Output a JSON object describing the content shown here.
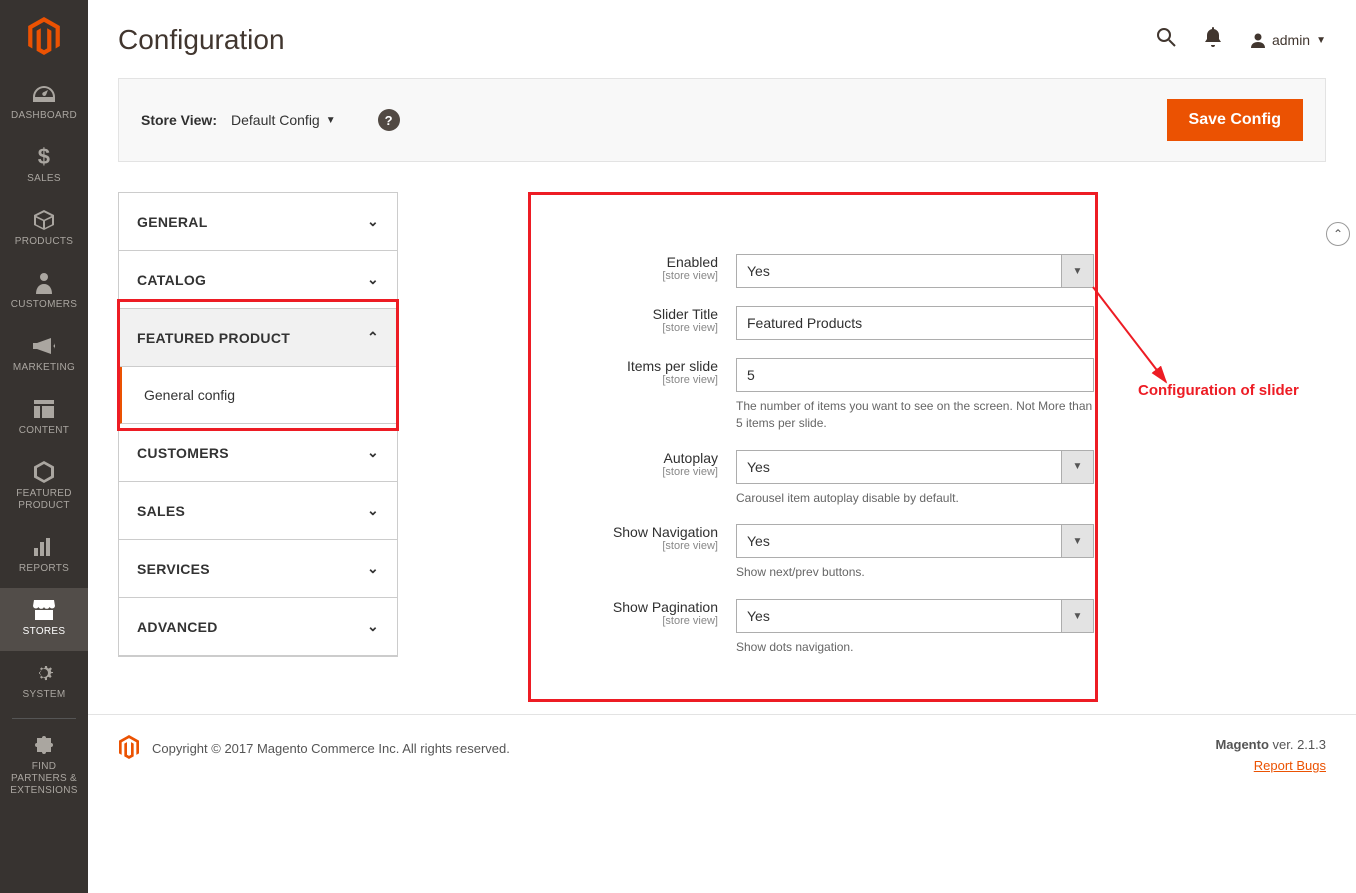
{
  "nav": {
    "items": [
      {
        "key": "dashboard",
        "label": "DASHBOARD"
      },
      {
        "key": "sales",
        "label": "SALES"
      },
      {
        "key": "products",
        "label": "PRODUCTS"
      },
      {
        "key": "customers",
        "label": "CUSTOMERS"
      },
      {
        "key": "marketing",
        "label": "MARKETING"
      },
      {
        "key": "content",
        "label": "CONTENT"
      },
      {
        "key": "featured-product",
        "label": "FEATURED PRODUCT"
      },
      {
        "key": "reports",
        "label": "REPORTS"
      },
      {
        "key": "stores",
        "label": "STORES"
      },
      {
        "key": "system",
        "label": "SYSTEM"
      },
      {
        "key": "find-partners",
        "label": "FIND PARTNERS & EXTENSIONS"
      }
    ]
  },
  "header": {
    "title": "Configuration",
    "admin_label": "admin"
  },
  "toolbar": {
    "store_view_label": "Store View:",
    "store_view_value": "Default Config",
    "save_label": "Save Config"
  },
  "config_tabs": [
    {
      "label": "GENERAL",
      "expanded": false
    },
    {
      "label": "CATALOG",
      "expanded": false
    },
    {
      "label": "FEATURED PRODUCT",
      "expanded": true,
      "sub": [
        {
          "label": "General config"
        }
      ]
    },
    {
      "label": "CUSTOMERS",
      "expanded": false
    },
    {
      "label": "SALES",
      "expanded": false
    },
    {
      "label": "SERVICES",
      "expanded": false
    },
    {
      "label": "ADVANCED",
      "expanded": false
    }
  ],
  "form": {
    "scope_text": "[store view]",
    "fields": {
      "enabled": {
        "label": "Enabled",
        "type": "select",
        "value": "Yes"
      },
      "slider_title": {
        "label": "Slider Title",
        "type": "text",
        "value": "Featured Products"
      },
      "items_per_slide": {
        "label": "Items per slide",
        "type": "text",
        "value": "5",
        "note": "The number of items you want to see on the screen. Not More than 5 items per slide."
      },
      "autoplay": {
        "label": "Autoplay",
        "type": "select",
        "value": "Yes",
        "note": "Carousel item autoplay disable by default."
      },
      "show_navigation": {
        "label": "Show Navigation",
        "type": "select",
        "value": "Yes",
        "note": "Show next/prev buttons."
      },
      "show_pagination": {
        "label": "Show Pagination",
        "type": "select",
        "value": "Yes",
        "note": "Show dots navigation."
      }
    }
  },
  "annotation": {
    "text": "Configuration of slider"
  },
  "footer": {
    "copyright": "Copyright © 2017 Magento Commerce Inc. All rights reserved.",
    "brand": "Magento",
    "version_label": "ver. 2.1.3",
    "report_bugs": "Report Bugs"
  }
}
